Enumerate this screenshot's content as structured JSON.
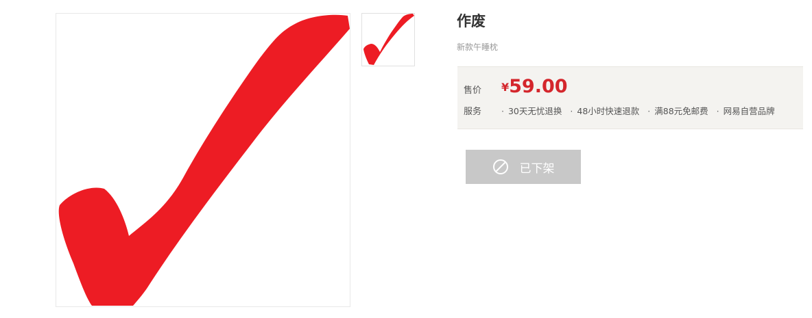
{
  "product": {
    "title": "作废",
    "subtitle": "新款午睡枕",
    "main_image_icon": "red-checkmark",
    "thumbnail_icon": "red-checkmark"
  },
  "price": {
    "label": "售价",
    "currency_symbol": "¥",
    "amount": "59.00",
    "color": "#d4262c"
  },
  "services": {
    "label": "服务",
    "items": [
      {
        "dot": "·",
        "text": "30天无忧退换"
      },
      {
        "dot": "·",
        "text": "48小时快速退款"
      },
      {
        "dot": "·",
        "text": "满88元免邮费"
      },
      {
        "dot": "·",
        "text": "网易自营品牌"
      }
    ]
  },
  "action": {
    "button_label": "已下架",
    "button_icon": "forbidden-icon",
    "button_color": "#c8c8c8"
  }
}
